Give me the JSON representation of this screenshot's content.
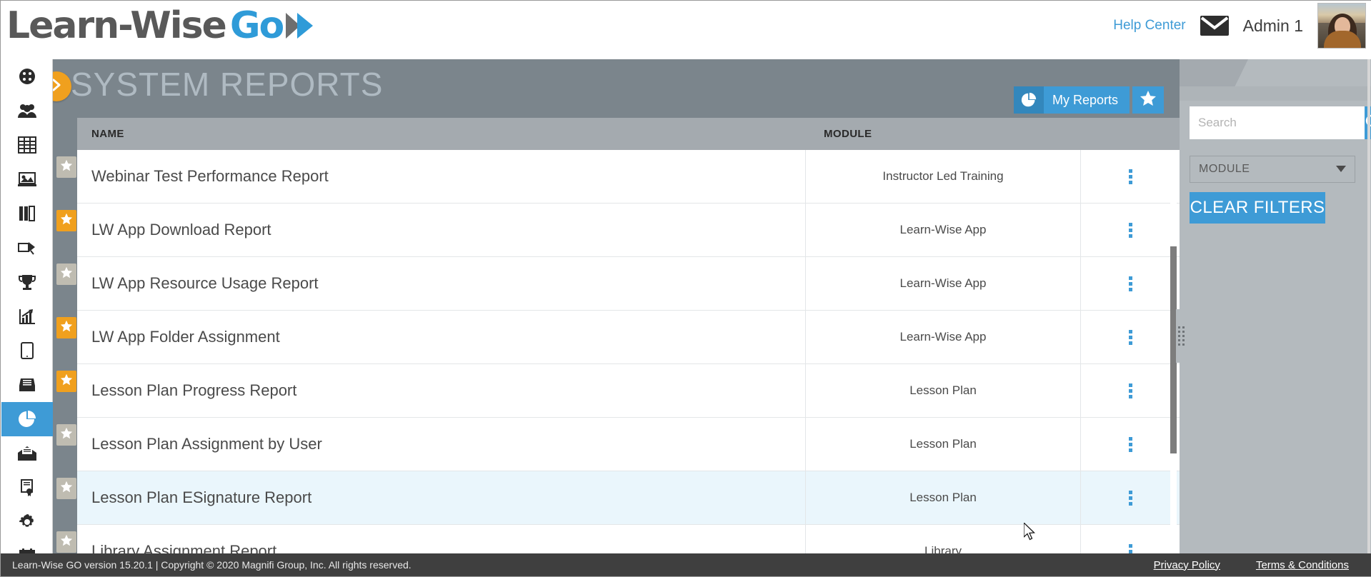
{
  "header": {
    "logo_text_1": "Learn-Wise",
    "logo_text_2": "Go",
    "logo_chevron_icon": "double-chevron-right-icon",
    "help_center": "Help Center",
    "mail_icon": "envelope-icon",
    "admin_name": "Admin 1",
    "avatar_icon": "user-avatar-photo"
  },
  "page": {
    "title": "SYSTEM REPORTS",
    "collapse_icon": "chevron-right-icon"
  },
  "toolbar": {
    "my_reports_label": "My Reports",
    "my_reports_icon": "pie-chart-icon",
    "favorite_icon": "star-icon"
  },
  "sidebar": {
    "items": [
      {
        "name": "dashboard",
        "icon": "gauge-icon",
        "active": false
      },
      {
        "name": "users",
        "icon": "people-icon",
        "active": false
      },
      {
        "name": "courses-grid",
        "icon": "table-grid-icon",
        "active": false
      },
      {
        "name": "presentation",
        "icon": "presentation-icon",
        "active": false
      },
      {
        "name": "library",
        "icon": "books-icon",
        "active": false
      },
      {
        "name": "announcements",
        "icon": "megaphone-icon",
        "active": false
      },
      {
        "name": "achievements",
        "icon": "trophy-icon",
        "active": false
      },
      {
        "name": "analytics",
        "icon": "bar-chart-icon",
        "active": false
      },
      {
        "name": "mobile-app",
        "icon": "tablet-icon",
        "active": false
      },
      {
        "name": "archive",
        "icon": "inbox-tray-icon",
        "active": false
      },
      {
        "name": "reports",
        "icon": "pie-chart-icon",
        "active": true
      },
      {
        "name": "messages",
        "icon": "open-envelope-icon",
        "active": false
      },
      {
        "name": "certificates",
        "icon": "certificate-icon",
        "active": false
      },
      {
        "name": "settings",
        "icon": "gear-icon",
        "active": false
      },
      {
        "name": "calendar",
        "icon": "calendar-icon",
        "active": false
      }
    ]
  },
  "table": {
    "columns": [
      "NAME",
      "MODULE"
    ],
    "row_menu_icon": "kebab-menu-icon",
    "rows": [
      {
        "starred": false,
        "name": "Webinar Test Performance Report",
        "module": "Instructor Led Training",
        "hover": false
      },
      {
        "starred": true,
        "name": "LW App Download Report",
        "module": "Learn-Wise App",
        "hover": false
      },
      {
        "starred": false,
        "name": "LW App Resource Usage Report",
        "module": "Learn-Wise App",
        "hover": false
      },
      {
        "starred": true,
        "name": "LW App Folder Assignment",
        "module": "Learn-Wise App",
        "hover": false
      },
      {
        "starred": true,
        "name": "Lesson Plan Progress Report",
        "module": "Lesson Plan",
        "hover": false
      },
      {
        "starred": false,
        "name": "Lesson Plan Assignment by User",
        "module": "Lesson Plan",
        "hover": false
      },
      {
        "starred": false,
        "name": "Lesson Plan ESignature Report",
        "module": "Lesson Plan",
        "hover": true
      },
      {
        "starred": false,
        "name": "Library Assignment Report",
        "module": "Library",
        "hover": false
      }
    ]
  },
  "filters": {
    "search_placeholder": "Search",
    "search_value": "",
    "search_icon": "magnifier-icon",
    "module_label": "MODULE",
    "module_caret_icon": "caret-down-icon",
    "clear_label": "CLEAR FILTERS"
  },
  "footer": {
    "copyright": "Learn-Wise GO version 15.20.1 | Copyright © 2020 Magnifi Group, Inc. All rights reserved.",
    "privacy": "Privacy Policy",
    "terms": "Terms & Conditions"
  },
  "colors": {
    "accent_blue": "#3E9BD6",
    "accent_orange": "#F0A01E",
    "header_slate": "#7B858C",
    "table_header_gray": "#A4AAAF",
    "panel_gray": "#B4BABE",
    "row_hover": "#EAF6FC",
    "footer_dark": "#3F3F3F"
  }
}
